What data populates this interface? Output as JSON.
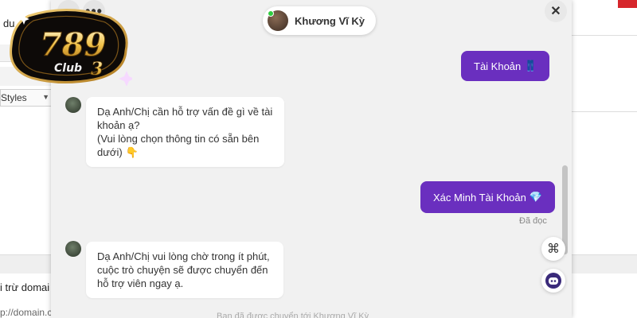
{
  "background": {
    "top_text": "du",
    "styles_label": "Styles",
    "bottom_text1": "i trừ domai",
    "bottom_text2": "p://domain.c"
  },
  "logo": {
    "text_789": "789",
    "text_club": "Club",
    "text_3": "3"
  },
  "header": {
    "back_glyph": "←",
    "more_glyph": "•••",
    "close_glyph": "✕",
    "agent_name": "Khương Vĩ Kỳ"
  },
  "messages": {
    "out1": {
      "text": "Tài Khoản",
      "emoji": "👖"
    },
    "in1": {
      "lines": [
        "Dạ Anh/Chị cần hỗ trợ vấn đề gì về tài",
        "khoản ạ?",
        "(Vui lòng chọn thông tin có sẵn bên",
        "dưới)"
      ],
      "emoji": "👇"
    },
    "out2": {
      "text": "Xác Minh Tài Khoản",
      "emoji": "💎"
    },
    "out2_status": "Đã đọc",
    "in2": {
      "lines": [
        "Dạ Anh/Chị vui lòng chờ trong ít phút,",
        "cuộc trò chuyện sẽ được chuyển đến",
        "hỗ trợ viên ngay ạ."
      ]
    }
  },
  "floating": {
    "apps_glyph": "⌘"
  },
  "footer_faded": "Bạn đã được chuyển tới Khương Vĩ Kỳ"
}
